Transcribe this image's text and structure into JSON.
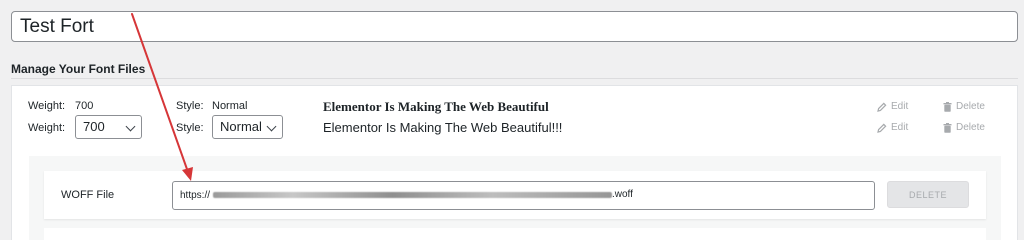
{
  "font_title": "Test Fort",
  "section_heading": "Manage Your Font Files",
  "variation": {
    "weight_label": "Weight:",
    "weight_value": "700",
    "style_label": "Style:",
    "style_value": "Normal",
    "weight_select_value": "700",
    "style_select_value": "Normal",
    "preview_current": "Elementor Is Making The Web Beautiful",
    "preview_edit": "Elementor Is Making The Web Beautiful!!!",
    "edit_label": "Edit",
    "delete_label": "Delete"
  },
  "file": {
    "label": "WOFF File",
    "url_prefix": "https://",
    "url_suffix": ".woff",
    "delete_button": "DELETE"
  },
  "colors": {
    "annotation_arrow": "#d63638",
    "muted_action": "#a7aaad"
  },
  "icons": [
    "pencil-icon",
    "trash-icon",
    "chevron-down-icon"
  ]
}
